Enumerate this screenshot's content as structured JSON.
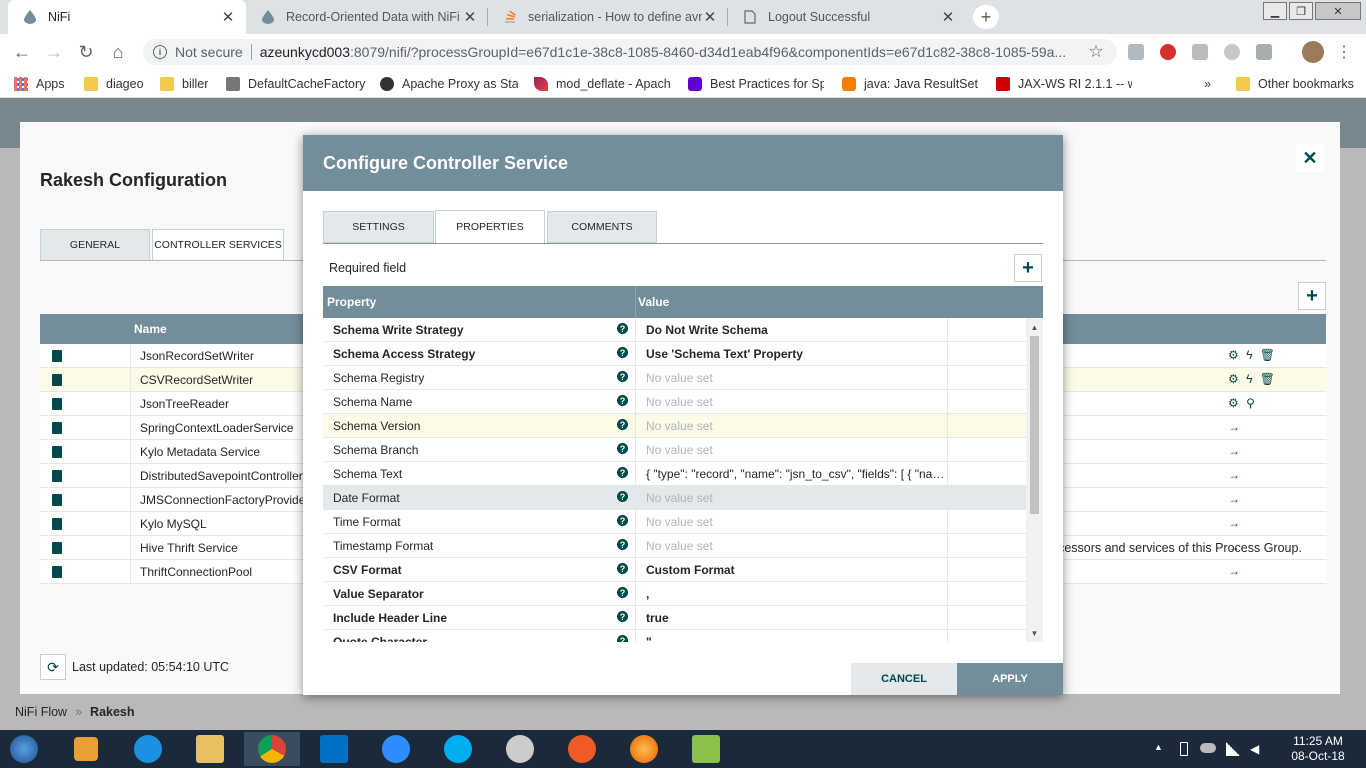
{
  "browser": {
    "tabs": [
      {
        "title": "NiFi",
        "active": true
      },
      {
        "title": "Record-Oriented Data with NiFi :"
      },
      {
        "title": "serialization - How to define avro"
      },
      {
        "title": "Logout Successful"
      }
    ],
    "address": {
      "security": "Not secure",
      "host": "azeunkycd003",
      "rest": ":8079/nifi/?processGroupId=e67d1c1e-38c8-1085-8460-d34d1eab4f96&componentIds=e67d1c82-38c8-1085-59a..."
    },
    "bookmarks": [
      {
        "label": "Apps",
        "icon": "apps-grid-icon"
      },
      {
        "label": "diageo",
        "icon": "folder-icon"
      },
      {
        "label": "biller",
        "icon": "folder-icon"
      },
      {
        "label": "DefaultCacheFactory",
        "icon": "jboss-icon"
      },
      {
        "label": "Apache Proxy as Stat",
        "icon": "site-icon"
      },
      {
        "label": "mod_deflate - Apach",
        "icon": "feather-icon"
      },
      {
        "label": "Best Practices for Spe",
        "icon": "yahoo-icon"
      },
      {
        "label": "java: Java ResultSet M",
        "icon": "blogger-icon"
      },
      {
        "label": "JAX-WS RI 2.1.1 -- ws",
        "icon": "oracle-icon"
      },
      {
        "label": "»",
        "icon": "chevron-more-icon"
      },
      {
        "label": "Other bookmarks",
        "icon": "folder-icon"
      }
    ]
  },
  "config": {
    "title": "Rakesh Configuration",
    "tabs": [
      "GENERAL",
      "CONTROLLER SERVICES"
    ],
    "table_header": "Name",
    "services": [
      {
        "name": "JsonRecordSetWriter",
        "actions": "⚙ ϟ 🗑"
      },
      {
        "name": "CSVRecordSetWriter",
        "actions": "⚙ ϟ 🗑",
        "highlighted": true
      },
      {
        "name": "JsonTreeReader",
        "actions": "⚙ ⚲"
      },
      {
        "name": "SpringContextLoaderService",
        "actions": "→"
      },
      {
        "name": "Kylo Metadata Service",
        "actions": "→"
      },
      {
        "name": "DistributedSavepointController",
        "actions": "→"
      },
      {
        "name": "JMSConnectionFactoryProvide",
        "actions": "→"
      },
      {
        "name": "Kylo MySQL",
        "actions": "→"
      },
      {
        "name": "Hive Thrift Service",
        "actions": "→"
      },
      {
        "name": "ThriftConnectionPool",
        "actions": "→"
      }
    ],
    "last_updated": "Last updated: 05:54:10 UTC",
    "footer_note": "processors and services of this Process Group."
  },
  "breadcrumb": {
    "root": "NiFi Flow",
    "sep": "»",
    "current": "Rakesh"
  },
  "dialog": {
    "title": "Configure Controller Service",
    "tabs": [
      "SETTINGS",
      "PROPERTIES",
      "COMMENTS"
    ],
    "active_tab": "PROPERTIES",
    "required_label": "Required field",
    "columns": {
      "property": "Property",
      "value": "Value"
    },
    "properties": [
      {
        "name": "Schema Write Strategy",
        "value": "Do Not Write Schema",
        "required": true
      },
      {
        "name": "Schema Access Strategy",
        "value": "Use 'Schema Text' Property",
        "required": true
      },
      {
        "name": "Schema Registry",
        "value": "No value set",
        "unset": true
      },
      {
        "name": "Schema Name",
        "value": "No value set",
        "unset": true
      },
      {
        "name": "Schema Version",
        "value": "No value set",
        "unset": true,
        "highlighted": true
      },
      {
        "name": "Schema Branch",
        "value": "No value set",
        "unset": true
      },
      {
        "name": "Schema Text",
        "value": "{ \"type\": \"record\", \"name\": \"jsn_to_csv\", \"fields\": [ { \"name..."
      },
      {
        "name": "Date Format",
        "value": "No value set",
        "unset": true,
        "selected": true
      },
      {
        "name": "Time Format",
        "value": "No value set",
        "unset": true
      },
      {
        "name": "Timestamp Format",
        "value": "No value set",
        "unset": true
      },
      {
        "name": "CSV Format",
        "value": "Custom Format",
        "required": true
      },
      {
        "name": "Value Separator",
        "value": ",",
        "required": true
      },
      {
        "name": "Include Header Line",
        "value": "true",
        "required": true
      },
      {
        "name": "Quote Character",
        "value": "\"",
        "required": true
      }
    ],
    "cancel": "CANCEL",
    "apply": "APPLY"
  },
  "taskbar": {
    "time": "11:25 AM",
    "date": "08-Oct-18"
  },
  "colors": {
    "nifi_header": "#728e9b",
    "nifi_accent": "#004849",
    "unset_text": "#aab6bc",
    "taskbar": "#1b2a3b"
  }
}
